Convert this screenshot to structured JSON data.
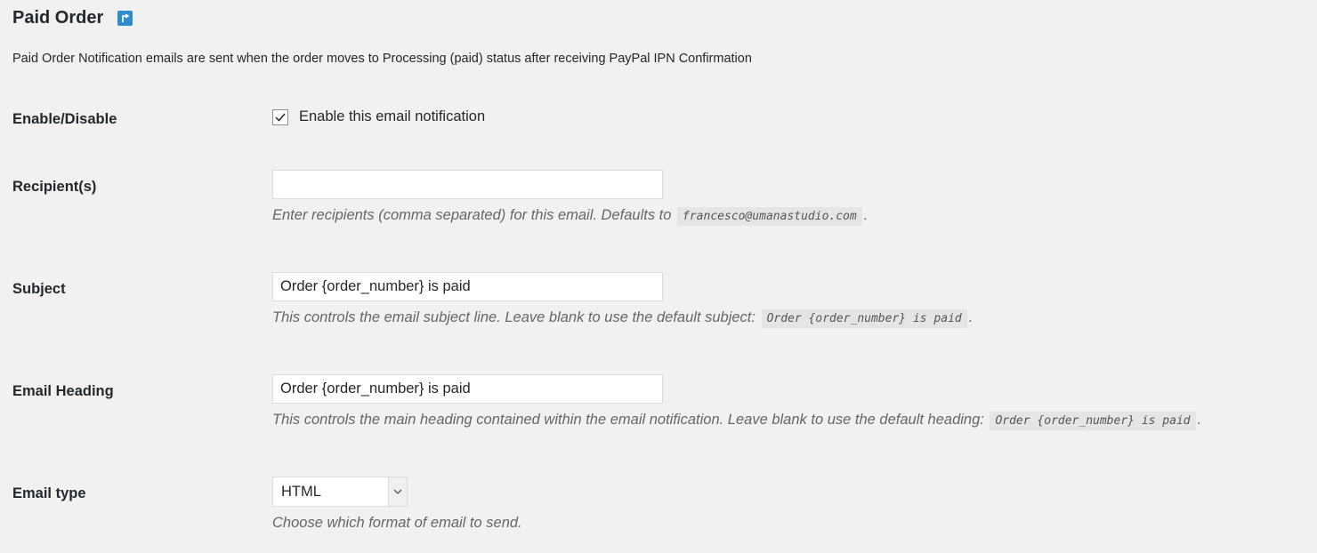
{
  "header": {
    "title": "Paid Order",
    "back_icon": "back-arrow-icon",
    "intro": "Paid Order Notification emails are sent when the order moves to Processing (paid) status after receiving PayPal IPN Confirmation"
  },
  "enable": {
    "label": "Enable/Disable",
    "checkbox_label": "Enable this email notification",
    "checked": true
  },
  "recipients": {
    "label": "Recipient(s)",
    "value": "",
    "desc_prefix": "Enter recipients (comma separated) for this email. Defaults to",
    "desc_code": "francesco@umanastudio.com",
    "desc_suffix": "."
  },
  "subject": {
    "label": "Subject",
    "value": "Order {order_number} is paid",
    "desc_prefix": "This controls the email subject line. Leave blank to use the default subject:",
    "desc_code": "Order {order_number} is paid",
    "desc_suffix": "."
  },
  "heading": {
    "label": "Email Heading",
    "value": "Order {order_number} is paid",
    "desc_prefix": "This controls the main heading contained within the email notification. Leave blank to use the default heading:",
    "desc_code": "Order {order_number} is paid",
    "desc_suffix": "."
  },
  "email_type": {
    "label": "Email type",
    "value": "HTML",
    "desc": "Choose which format of email to send."
  },
  "colors": {
    "background": "#f1f1f1",
    "accent": "#2e8ccc"
  }
}
